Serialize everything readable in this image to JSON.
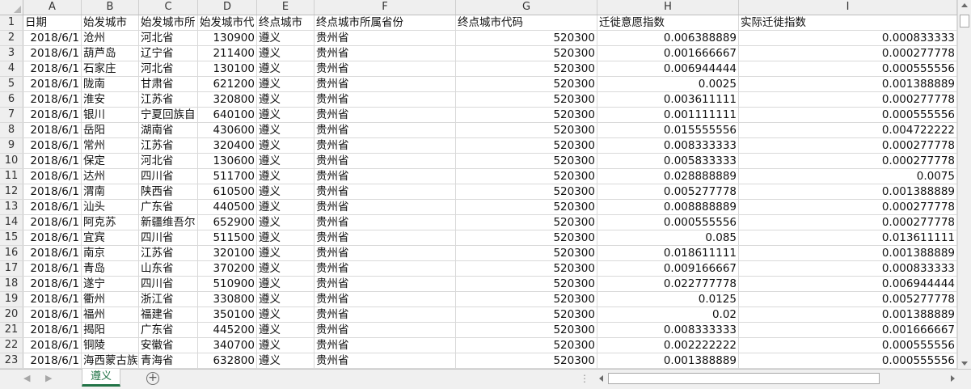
{
  "sheet": {
    "column_letters": [
      "A",
      "B",
      "C",
      "D",
      "E",
      "F",
      "G",
      "H",
      "I"
    ],
    "row_numbers": [
      "1",
      "2",
      "3",
      "4",
      "5",
      "6",
      "7",
      "8",
      "9",
      "10",
      "11",
      "12",
      "13",
      "14",
      "15",
      "16",
      "17",
      "18",
      "19",
      "20",
      "21",
      "22",
      "23"
    ],
    "header_cells": [
      "日期",
      "始发城市",
      "始发城市所",
      "始发城市代",
      "终点城市",
      "终点城市所属省份",
      "终点城市代码",
      "迁徙意愿指数",
      "实际迁徙指数"
    ],
    "rows": [
      [
        "2018/6/1",
        "沧州",
        "河北省",
        "130900",
        "遵义",
        "贵州省",
        "520300",
        "0.006388889",
        "0.000833333"
      ],
      [
        "2018/6/1",
        "葫芦岛",
        "辽宁省",
        "211400",
        "遵义",
        "贵州省",
        "520300",
        "0.001666667",
        "0.000277778"
      ],
      [
        "2018/6/1",
        "石家庄",
        "河北省",
        "130100",
        "遵义",
        "贵州省",
        "520300",
        "0.006944444",
        "0.000555556"
      ],
      [
        "2018/6/1",
        "陇南",
        "甘肃省",
        "621200",
        "遵义",
        "贵州省",
        "520300",
        "0.0025",
        "0.001388889"
      ],
      [
        "2018/6/1",
        "淮安",
        "江苏省",
        "320800",
        "遵义",
        "贵州省",
        "520300",
        "0.003611111",
        "0.000277778"
      ],
      [
        "2018/6/1",
        "银川",
        "宁夏回族自",
        "640100",
        "遵义",
        "贵州省",
        "520300",
        "0.001111111",
        "0.000555556"
      ],
      [
        "2018/6/1",
        "岳阳",
        "湖南省",
        "430600",
        "遵义",
        "贵州省",
        "520300",
        "0.015555556",
        "0.004722222"
      ],
      [
        "2018/6/1",
        "常州",
        "江苏省",
        "320400",
        "遵义",
        "贵州省",
        "520300",
        "0.008333333",
        "0.000277778"
      ],
      [
        "2018/6/1",
        "保定",
        "河北省",
        "130600",
        "遵义",
        "贵州省",
        "520300",
        "0.005833333",
        "0.000277778"
      ],
      [
        "2018/6/1",
        "达州",
        "四川省",
        "511700",
        "遵义",
        "贵州省",
        "520300",
        "0.028888889",
        "0.0075"
      ],
      [
        "2018/6/1",
        "渭南",
        "陕西省",
        "610500",
        "遵义",
        "贵州省",
        "520300",
        "0.005277778",
        "0.001388889"
      ],
      [
        "2018/6/1",
        "汕头",
        "广东省",
        "440500",
        "遵义",
        "贵州省",
        "520300",
        "0.008888889",
        "0.000277778"
      ],
      [
        "2018/6/1",
        "阿克苏",
        "新疆维吾尔",
        "652900",
        "遵义",
        "贵州省",
        "520300",
        "0.000555556",
        "0.000277778"
      ],
      [
        "2018/6/1",
        "宜宾",
        "四川省",
        "511500",
        "遵义",
        "贵州省",
        "520300",
        "0.085",
        "0.013611111"
      ],
      [
        "2018/6/1",
        "南京",
        "江苏省",
        "320100",
        "遵义",
        "贵州省",
        "520300",
        "0.018611111",
        "0.001388889"
      ],
      [
        "2018/6/1",
        "青岛",
        "山东省",
        "370200",
        "遵义",
        "贵州省",
        "520300",
        "0.009166667",
        "0.000833333"
      ],
      [
        "2018/6/1",
        "遂宁",
        "四川省",
        "510900",
        "遵义",
        "贵州省",
        "520300",
        "0.022777778",
        "0.006944444"
      ],
      [
        "2018/6/1",
        "衢州",
        "浙江省",
        "330800",
        "遵义",
        "贵州省",
        "520300",
        "0.0125",
        "0.005277778"
      ],
      [
        "2018/6/1",
        "福州",
        "福建省",
        "350100",
        "遵义",
        "贵州省",
        "520300",
        "0.02",
        "0.001388889"
      ],
      [
        "2018/6/1",
        "揭阳",
        "广东省",
        "445200",
        "遵义",
        "贵州省",
        "520300",
        "0.008333333",
        "0.001666667"
      ],
      [
        "2018/6/1",
        "铜陵",
        "安徽省",
        "340700",
        "遵义",
        "贵州省",
        "520300",
        "0.002222222",
        "0.000555556"
      ],
      [
        "2018/6/1",
        "海西蒙古族",
        "青海省",
        "632800",
        "遵义",
        "贵州省",
        "520300",
        "0.001388889",
        "0.000555556"
      ]
    ]
  },
  "tabs": {
    "active_tab_label": "遵义",
    "prev_glyph": "◀",
    "next_glyph": "▶",
    "add_glyph": "+",
    "more_glyph": "⋮"
  },
  "colors": {
    "accent": "#217346",
    "header_bg": "#efefef",
    "gridline": "#d9d9d9"
  }
}
